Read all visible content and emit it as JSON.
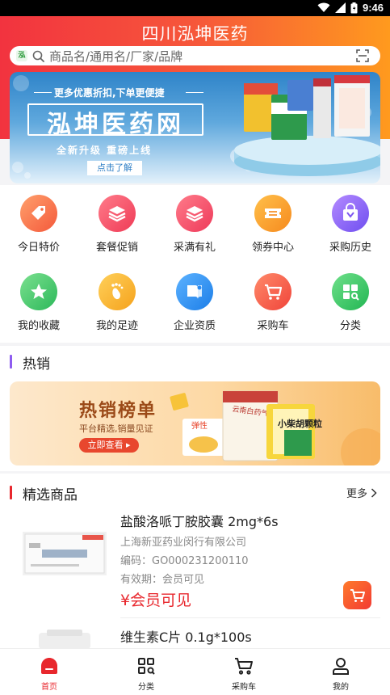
{
  "status_bar": {
    "time": "9:46"
  },
  "header": {
    "title": "四川泓坤医药"
  },
  "search": {
    "placeholder": "商品名/通用名/厂家/品牌",
    "logo_text": "泓"
  },
  "banner": {
    "subtitle": "更多优惠折扣,下单更便捷",
    "headline": "泓坤医药网",
    "slogan": "全新升级  重磅上线",
    "button": "点击了解"
  },
  "quick_menu": [
    {
      "label": "今日特价",
      "icon": "price-tag-icon",
      "color": "#f4754a"
    },
    {
      "label": "套餐促销",
      "icon": "stack-icon",
      "color": "#f25066"
    },
    {
      "label": "采满有礼",
      "icon": "stack-icon",
      "color": "#f04f6a"
    },
    {
      "label": "领券中心",
      "icon": "coupon-icon",
      "color": "#f79a25"
    },
    {
      "label": "采购历史",
      "icon": "bag-icon",
      "color": "#8e5cf0"
    },
    {
      "label": "我的收藏",
      "icon": "star-icon",
      "color": "#36c46a"
    },
    {
      "label": "我的足迹",
      "icon": "footprint-icon",
      "color": "#f6b42a"
    },
    {
      "label": "企业资质",
      "icon": "certificate-icon",
      "color": "#2d8ef0"
    },
    {
      "label": "采购车",
      "icon": "cart-icon",
      "color": "#f0553b"
    },
    {
      "label": "分类",
      "icon": "category-icon",
      "color": "#2fbf5f"
    }
  ],
  "hot": {
    "title": "热销",
    "banner_title": "热销榜单",
    "banner_sub": "平台精选,销量见证",
    "banner_button": "立即查看 ▸",
    "box_text_1": "云南白药气雾剂",
    "box_text_2": "小柴胡颗粒",
    "box_text_3": "弹性"
  },
  "featured": {
    "title": "精选商品",
    "more": "更多",
    "products": [
      {
        "name": "盐酸洛哌丁胺胶囊 2mg*6s",
        "maker": "上海新亚药业闵行有限公司",
        "code": "编码：GO000231200110",
        "expiry": "有效期：会员可见",
        "price": "¥会员可见"
      },
      {
        "name": "维生素C片 0.1g*100s",
        "maker": "",
        "code": "",
        "expiry": "",
        "price": ""
      }
    ]
  },
  "tabbar": [
    {
      "label": "首页",
      "icon": "home-icon",
      "active": true
    },
    {
      "label": "分类",
      "icon": "category-grid-icon",
      "active": false
    },
    {
      "label": "采购车",
      "icon": "cart-icon",
      "active": false
    },
    {
      "label": "我的",
      "icon": "user-icon",
      "active": false
    }
  ],
  "colors": {
    "accent": "#e8272d",
    "header_start": "#f2333f",
    "header_end": "#ff9a1e"
  }
}
